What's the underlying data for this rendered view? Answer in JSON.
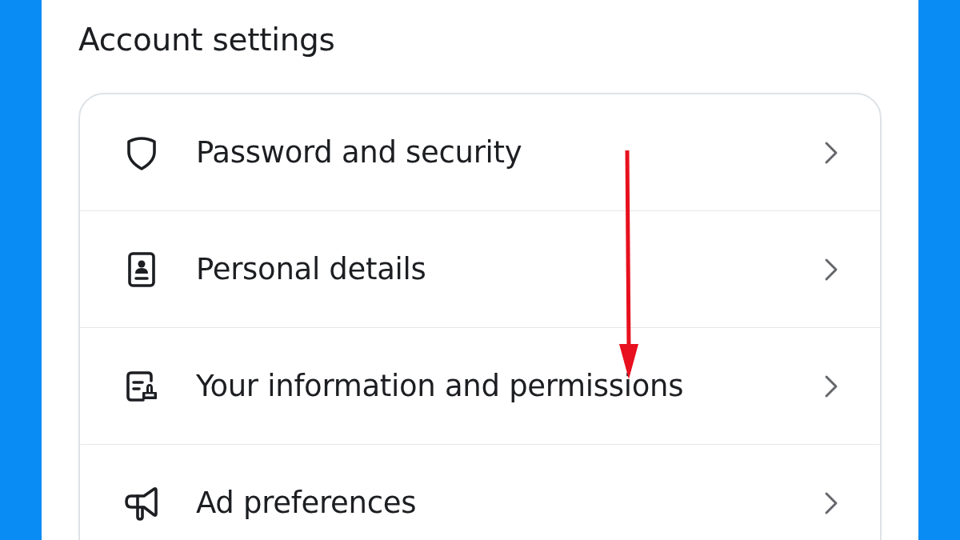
{
  "title": "Account settings",
  "items": [
    {
      "kind": "shield",
      "label": "Password and security"
    },
    {
      "kind": "id-card",
      "label": "Personal details"
    },
    {
      "kind": "document-stamp",
      "label": "Your information and permissions"
    },
    {
      "kind": "megaphone",
      "label": "Ad preferences"
    }
  ]
}
